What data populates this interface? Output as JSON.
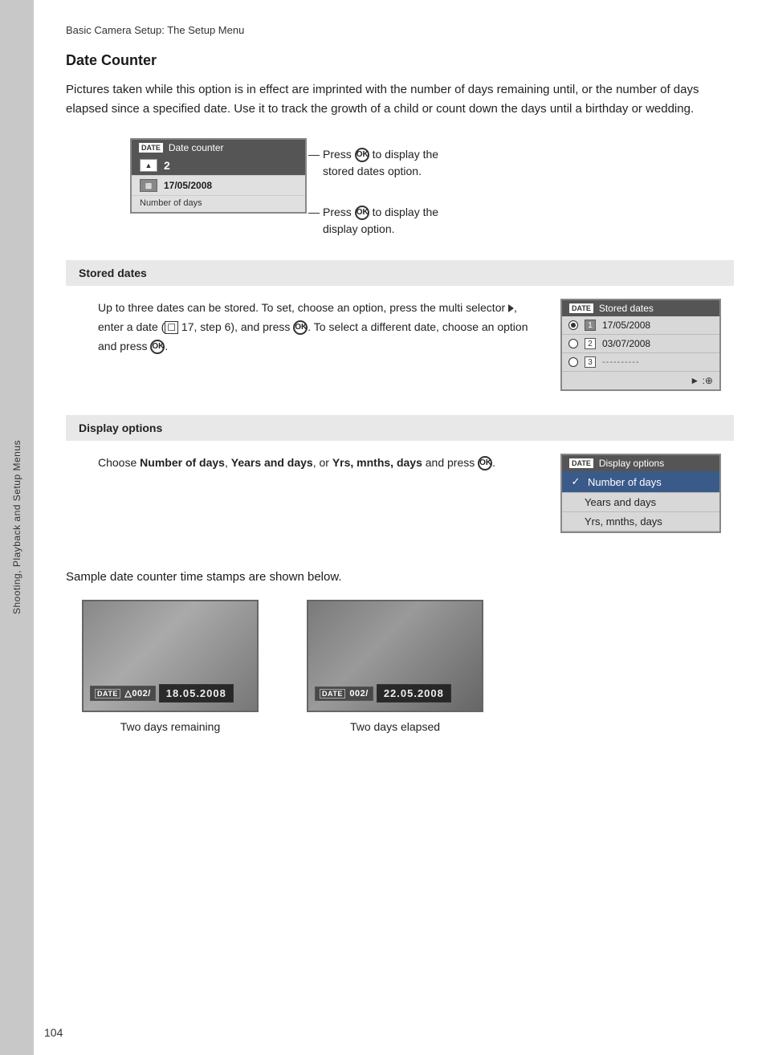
{
  "breadcrumb": "Basic Camera Setup: The Setup Menu",
  "section_title": "Date Counter",
  "intro_text": "Pictures taken while this option is in effect are imprinted with the number of days remaining until, or the number of days elapsed since a specified date. Use it to track the growth of a child or count down the days until a birthday or wedding.",
  "date_counter_screen": {
    "title": "Date counter",
    "row1": {
      "num": "2"
    },
    "row2": {
      "date": "17/05/2008"
    },
    "row3": {
      "label": "Number of days"
    }
  },
  "callout1": "Press ⒪ to display the stored dates option.",
  "callout2": "Press ⒪ to display the display option.",
  "stored_dates_section": {
    "box_title": "Stored dates",
    "body_text": "Up to three dates can be stored. To set, choose an option, press the multi selector ►, enter a date (ⓢ 17, step 6), and press ⒪. To select a different date, choose an option and press ⒪.",
    "screen_title": "Stored  dates",
    "rows": [
      {
        "radio": "filled",
        "num": "1",
        "date": "17/05/2008"
      },
      {
        "radio": "empty",
        "num": "2",
        "date": "03/07/2008"
      },
      {
        "radio": "empty",
        "num": "3",
        "date": "----------"
      }
    ],
    "footer": "► :⊕"
  },
  "display_options_section": {
    "box_title": "Display options",
    "body_text_before": "Choose ",
    "bold1": "Number of days",
    "body_text_mid1": ", ",
    "bold2": "Years and days",
    "body_text_mid2": ", or ",
    "bold3": "Yrs, mnths, days",
    "body_text_after": " and press ⒪.",
    "screen_title": "Display options",
    "options": [
      {
        "label": "Number of days",
        "selected": true
      },
      {
        "label": "Years and days",
        "selected": false
      },
      {
        "label": "Yrs, mnths, days",
        "selected": false
      }
    ]
  },
  "sample_section": {
    "intro": "Sample date counter time stamps are shown below.",
    "items": [
      {
        "stamp": "ⓐ002/",
        "date": "18.05.2008",
        "caption": "Two days remaining"
      },
      {
        "stamp": "002/",
        "date": "22.05.2008",
        "caption": "Two days elapsed"
      }
    ]
  },
  "sidebar_text": "Shooting, Playback and Setup Menus",
  "page_number": "104"
}
